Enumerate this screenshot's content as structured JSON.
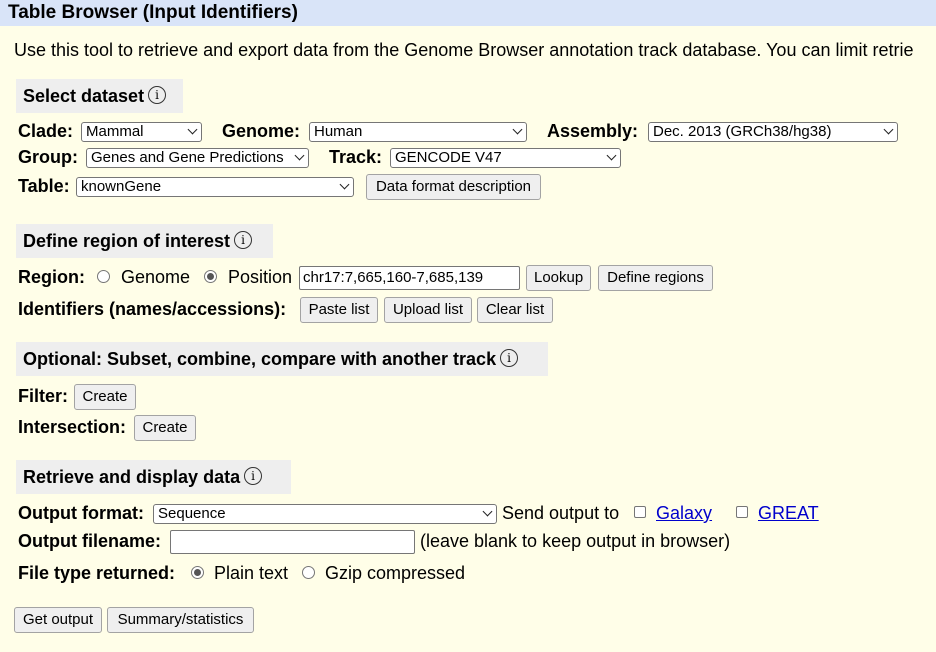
{
  "title": "Table Browser (Input Identifiers)",
  "intro": "Use this tool to retrieve and export data from the Genome Browser annotation track database. You can limit retrie",
  "sections": {
    "select_dataset": "Select dataset",
    "define_region": "Define region of interest",
    "optional": "Optional: Subset, combine, compare with another track",
    "retrieve": "Retrieve and display data"
  },
  "info_glyph": "i",
  "dataset": {
    "clade_label": "Clade:",
    "clade_value": "Mammal",
    "genome_label": "Genome:",
    "genome_value": "Human",
    "assembly_label": "Assembly:",
    "assembly_value": "Dec. 2013 (GRCh38/hg38)",
    "group_label": "Group:",
    "group_value": "Genes and Gene Predictions",
    "track_label": "Track:",
    "track_value": "GENCODE V47",
    "table_label": "Table:",
    "table_value": "knownGene",
    "data_format_button": "Data format description"
  },
  "region": {
    "region_label": "Region:",
    "genome_option": "Genome",
    "position_option": "Position",
    "selected": "Position",
    "position_value": "chr17:7,665,160-7,685,139",
    "lookup_button": "Lookup",
    "define_regions_button": "Define regions",
    "identifiers_label": "Identifiers (names/accessions):",
    "paste_list_button": "Paste list",
    "upload_list_button": "Upload list",
    "clear_list_button": "Clear list"
  },
  "optional": {
    "filter_label": "Filter:",
    "filter_button": "Create",
    "intersection_label": "Intersection:",
    "intersection_button": "Create"
  },
  "retrieve": {
    "output_format_label": "Output format:",
    "output_format_value": "Sequence",
    "send_output_label": "Send output to",
    "galaxy_link": "Galaxy",
    "great_link": "GREAT",
    "output_filename_label": "Output filename:",
    "output_filename_value": "",
    "filename_hint": "(leave blank to keep output in browser)",
    "file_type_label": "File type returned:",
    "plain_text_option": "Plain text",
    "gzip_option": "Gzip compressed",
    "file_type_selected": "Plain text"
  },
  "actions": {
    "get_output_button": "Get output",
    "summary_button": "Summary/statistics"
  },
  "colors": {
    "background": "#fffee8",
    "title_bar": "#d9e4f8",
    "section_header": "#eeeeee",
    "link": "#0000cc"
  }
}
